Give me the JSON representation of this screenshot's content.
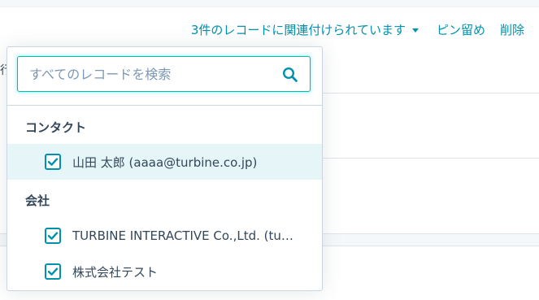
{
  "actions": {
    "associated": "3件のレコードに関連付けられています",
    "pin": "ピン留め",
    "delete": "削除"
  },
  "background": {
    "stub_text": "行"
  },
  "dropdown": {
    "search_placeholder": "すべてのレコードを検索",
    "sections": [
      {
        "label": "コンタクト",
        "items": [
          {
            "label": "山田 太郎 (aaaa@turbine.co.jp)",
            "checked": true,
            "highlighted": true
          }
        ]
      },
      {
        "label": "会社",
        "items": [
          {
            "label": "TURBINE INTERACTIVE Co.,Ltd. (tu…",
            "checked": true,
            "highlighted": false
          },
          {
            "label": "株式会社テスト",
            "checked": true,
            "highlighted": false
          }
        ]
      }
    ]
  },
  "colors": {
    "accent": "#0091ae",
    "focus_border": "#00bda5",
    "highlight_row": "#e5f5f8",
    "text": "#33475b"
  }
}
